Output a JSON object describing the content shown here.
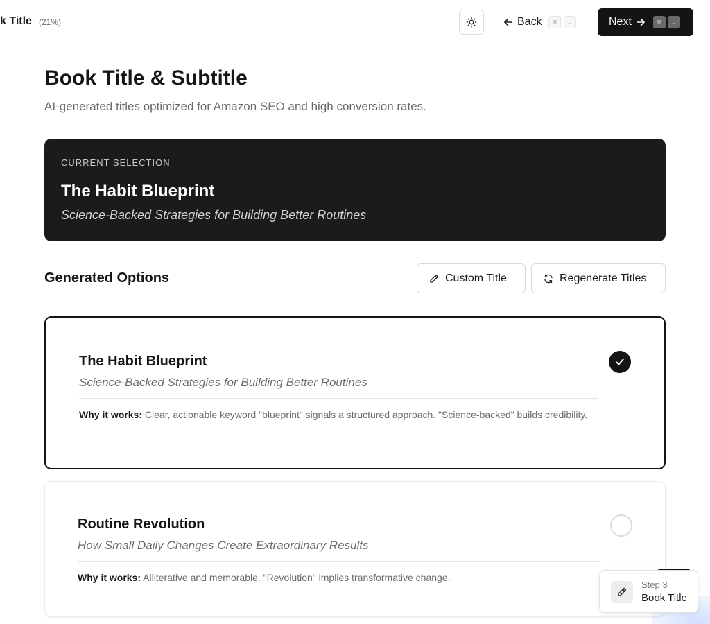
{
  "header": {
    "breadcrumb": "k Title",
    "progress": "(21%)",
    "theme_icon": "sun-icon",
    "back_label": "Back",
    "back_keys": [
      "⌘",
      "←"
    ],
    "next_label": "Next",
    "next_keys": [
      "⌘",
      "→"
    ]
  },
  "page": {
    "title": "Book Title & Subtitle",
    "subtitle": "AI-generated titles optimized for Amazon SEO and high conversion rates."
  },
  "current_selection": {
    "label": "CURRENT SELECTION",
    "title": "The Habit Blueprint",
    "subtitle": "Science-Backed Strategies for Building Better Routines"
  },
  "options_section": {
    "heading": "Generated Options",
    "custom_button": "Custom Title",
    "regenerate_button": "Regenerate Titles"
  },
  "options": [
    {
      "title": "The Habit Blueprint",
      "subtitle": "Science-Backed Strategies for Building Better Routines",
      "why_label": "Why it works:",
      "why_text": "Clear, actionable keyword \"blueprint\" signals a structured approach. \"Science-backed\" builds credibility.",
      "selected": true
    },
    {
      "title": "Routine Revolution",
      "subtitle": "How Small Daily Changes Create Extraordinary Results",
      "why_label": "Why it works:",
      "why_text": "Alliterative and memorable. \"Revolution\" implies transformative change.",
      "selected": false
    }
  ],
  "step_toast": {
    "step": "Step 3",
    "name": "Book Title",
    "icon": "pencil-icon"
  },
  "colors": {
    "primary": "#141414",
    "muted_text": "#6b6b6b",
    "border": "#d9d9d9"
  }
}
